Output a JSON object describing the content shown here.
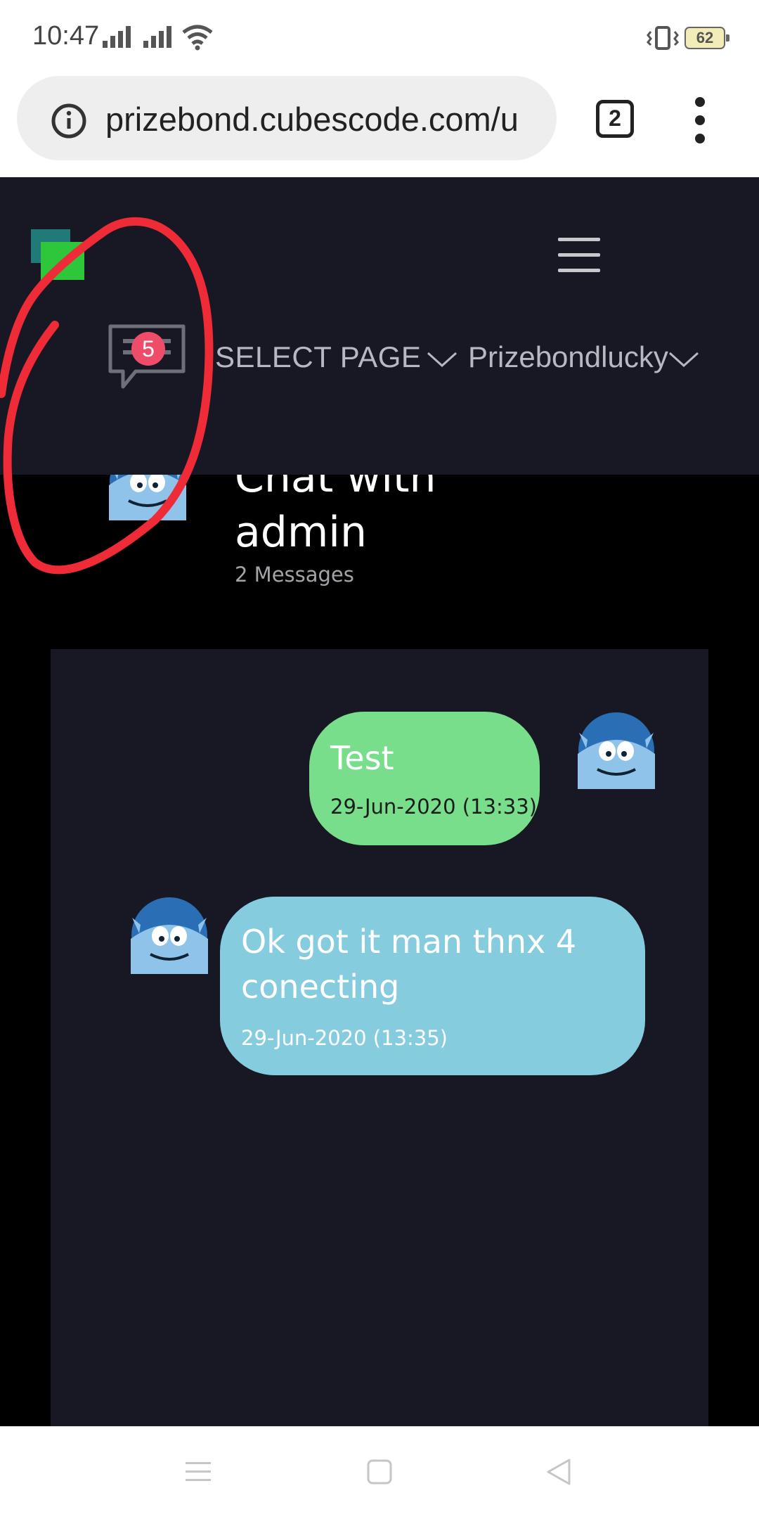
{
  "status_bar": {
    "time": "10:47",
    "battery": "62",
    "icons": [
      "signal-icon",
      "signal-icon",
      "wifi-icon",
      "vibrate-icon",
      "battery-icon"
    ]
  },
  "browser": {
    "url": "prizebond.cubescode.com/u",
    "tab_count": "2",
    "icons": [
      "info-icon",
      "tabs-icon",
      "more-vert-icon"
    ]
  },
  "header": {
    "logo_colors": [
      "#1f7a78",
      "#2ec63a"
    ],
    "chat_badge_count": "5",
    "nav_select_page": "SELECT PAGE",
    "nav_user": "Prizebondlucky",
    "icons": [
      "menu-icon",
      "chat-icon",
      "chevron-down-icon"
    ]
  },
  "chat": {
    "title": "Chat with admin",
    "message_count": "2 Messages",
    "messages": [
      {
        "text": "Test",
        "time": "29-Jun-2020 (13:33)",
        "side": "sent",
        "color": "#79de8c"
      },
      {
        "text": "Ok got it man thnx 4 conecting",
        "time": "29-Jun-2020 (13:35)",
        "side": "received",
        "color": "#85ccde"
      }
    ]
  },
  "colors": {
    "header_bg": "#171824",
    "page_bg": "#000000",
    "badge": "#ef4c6a",
    "annotation": "#ee2b36"
  },
  "nav_bar": {
    "icons": [
      "recents-icon",
      "home-icon",
      "back-icon"
    ]
  }
}
